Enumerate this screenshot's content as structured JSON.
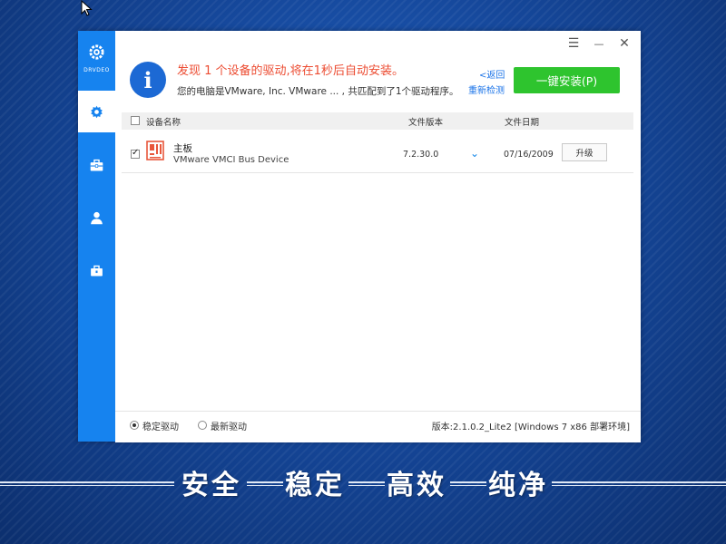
{
  "sidebar": {
    "logo_text": "DRVDEO",
    "items": [
      {
        "icon": "gear-icon",
        "active": true
      },
      {
        "icon": "toolbox-icon",
        "active": false
      },
      {
        "icon": "user-icon",
        "active": false
      },
      {
        "icon": "briefcase-icon",
        "active": false
      }
    ]
  },
  "titlebar": {
    "menu": "☰",
    "minimize": "—",
    "close": "✕"
  },
  "header": {
    "headline": "发现 1 个设备的驱动,将在1秒后自动安装。",
    "subline": "您的电脑是VMware, Inc. VMware ... , 共匹配到了1个驱动程序。",
    "back_link": "<返回",
    "rescan_link": "重新检测",
    "install_button": "一键安装(P)"
  },
  "table": {
    "columns": {
      "name": "设备名称",
      "version": "文件版本",
      "date": "文件日期"
    },
    "rows": [
      {
        "checked": true,
        "name": "主板",
        "description": "VMware VMCI Bus Device",
        "version": "7.2.30.0",
        "date": "07/16/2009",
        "action": "升级"
      }
    ]
  },
  "footer": {
    "stable_label": "稳定驱动",
    "latest_label": "最新驱动",
    "selected": "stable",
    "version_info": "版本:2.1.0.2_Lite2 [Windows 7 x86 部署环境]"
  },
  "slogan": [
    "安全",
    "稳定",
    "高效",
    "纯净"
  ],
  "colors": {
    "sidebar": "#1683ef",
    "install": "#2ec42e",
    "headline": "#ec4b31",
    "link": "#1a73e8"
  }
}
